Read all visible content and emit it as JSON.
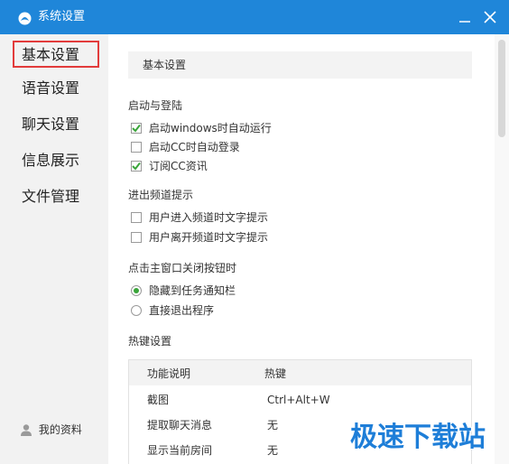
{
  "window": {
    "title": "系统设置",
    "min_symbol": "—",
    "close_symbol": "✕",
    "accent": "#1f86d9"
  },
  "sidebar": {
    "items": [
      {
        "label": "基本设置",
        "active": true
      },
      {
        "label": "语音设置",
        "active": false
      },
      {
        "label": "聊天设置",
        "active": false
      },
      {
        "label": "信息展示",
        "active": false
      },
      {
        "label": "文件管理",
        "active": false
      }
    ],
    "profile_label": "我的资料",
    "profile_icon": "person-icon"
  },
  "main": {
    "heading": "基本设置",
    "startup": {
      "title": "启动与登陆",
      "options": [
        {
          "label": "启动windows时自动运行",
          "checked": true
        },
        {
          "label": "启动CC时自动登录",
          "checked": false
        },
        {
          "label": "订阅CC资讯",
          "checked": true
        }
      ]
    },
    "channel": {
      "title": "进出频道提示",
      "options": [
        {
          "label": "用户进入频道时文字提示",
          "checked": false
        },
        {
          "label": "用户离开频道时文字提示",
          "checked": false
        }
      ]
    },
    "close_action": {
      "title": "点击主窗口关闭按钮时",
      "options": [
        {
          "label": "隐藏到任务通知栏",
          "selected": true
        },
        {
          "label": "直接退出程序",
          "selected": false
        }
      ]
    },
    "hotkeys": {
      "title": "热键设置",
      "headers": [
        "功能说明",
        "热键"
      ],
      "rows": [
        {
          "name": "截图",
          "key": "Ctrl+Alt+W"
        },
        {
          "name": "提取聊天消息",
          "key": "无"
        },
        {
          "name": "显示当前房间",
          "key": "无"
        }
      ]
    }
  },
  "watermark": "极速下载站",
  "colors": {
    "check": "#3aa53a",
    "active_border": "#e23b3b"
  }
}
